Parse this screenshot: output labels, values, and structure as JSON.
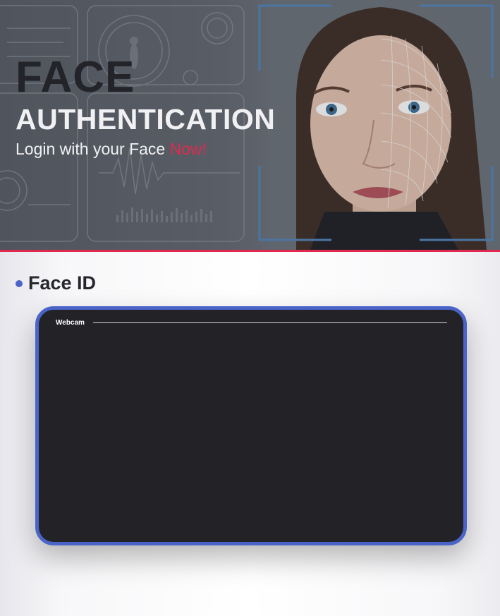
{
  "hero": {
    "title_line1": "FACE",
    "title_line2": "AUTHENTICATION",
    "subtitle_prefix": "Login with your Face ",
    "subtitle_highlight": "Now!"
  },
  "section": {
    "title": "Face ID"
  },
  "webcam": {
    "legend": "Webcam"
  },
  "colors": {
    "accent_red": "#e0294f",
    "accent_blue": "#4a64c8",
    "panel_bg": "#232227"
  }
}
